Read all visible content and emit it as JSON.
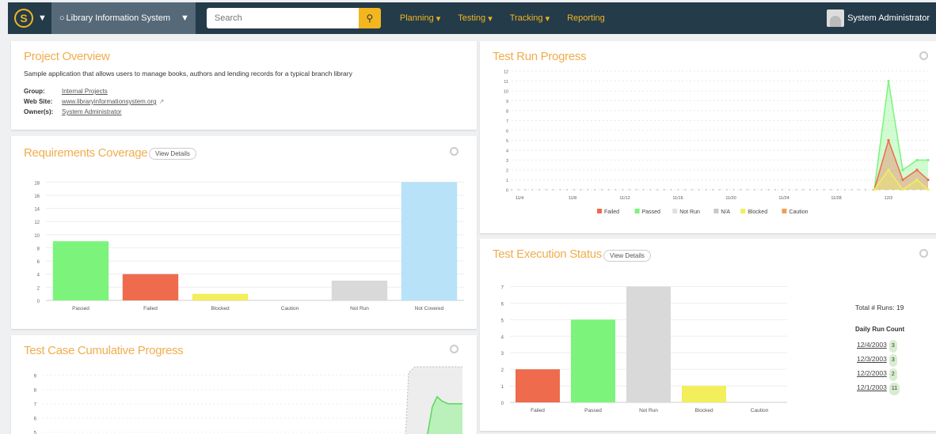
{
  "topbar": {
    "project_name": "Library Information System",
    "search_placeholder": "Search",
    "nav": [
      "Planning",
      "Testing",
      "Tracking",
      "Reporting"
    ],
    "user_name": "System Administrator"
  },
  "overview": {
    "title": "Project Overview",
    "description": "Sample application that allows users to manage books, authors and lending records for a typical branch library",
    "group_label": "Group:",
    "group_value": "Internal Projects",
    "website_label": "Web Site:",
    "website_value": "www.libraryinformationsystem.org",
    "owner_label": "Owner(s):",
    "owner_value": "System Administrator"
  },
  "requirements": {
    "title": "Requirements Coverage",
    "view_details": "View Details"
  },
  "cumulative": {
    "title": "Test Case Cumulative Progress"
  },
  "run_progress": {
    "title": "Test Run Progress"
  },
  "execution": {
    "title": "Test Execution Status",
    "view_details": "View Details",
    "total_runs_label": "Total # Runs:",
    "total_runs_value": "19",
    "daily_label": "Daily Run Count",
    "daily": [
      {
        "date": "12/4/2003",
        "count": "3"
      },
      {
        "date": "12/3/2003",
        "count": "3"
      },
      {
        "date": "12/2/2003",
        "count": "2"
      },
      {
        "date": "12/1/2003",
        "count": "11"
      }
    ]
  },
  "chart_data": [
    {
      "type": "bar",
      "title": "Requirements Coverage",
      "categories": [
        "Passed",
        "Failed",
        "Blocked",
        "Caution",
        "Not Run",
        "Not Covered"
      ],
      "values": [
        9,
        4,
        1,
        0,
        3,
        18
      ],
      "colors": [
        "#7cf47c",
        "#ee6b4d",
        "#f2ee5c",
        "#f0a050",
        "#d9d9d9",
        "#b7e2f7"
      ],
      "yticks": [
        0,
        2,
        4,
        6,
        8,
        10,
        12,
        14,
        16,
        18
      ],
      "ylim": [
        0,
        19
      ]
    },
    {
      "type": "area",
      "title": "Test Run Progress",
      "x": [
        "11/4",
        "11/8",
        "11/12",
        "11/16",
        "11/20",
        "11/24",
        "11/28",
        "12/2"
      ],
      "yticks": [
        0,
        1,
        2,
        3,
        4,
        5,
        6,
        7,
        8,
        9,
        10,
        11,
        12
      ],
      "ylim": [
        0,
        12
      ],
      "legend_position": "bottom",
      "series": [
        {
          "name": "Failed",
          "color": "#ee6b4d"
        },
        {
          "name": "Passed",
          "color": "#7cf47c"
        },
        {
          "name": "Not Run",
          "color": "#e0e0e0"
        },
        {
          "name": "N/A",
          "color": "#c8c8c8"
        },
        {
          "name": "Blocked",
          "color": "#f2ee5c"
        },
        {
          "name": "Caution",
          "color": "#f0a050"
        }
      ],
      "passed_tail": [
        0,
        11,
        2,
        3,
        3
      ],
      "failed_tail": [
        0,
        5,
        1,
        2,
        1
      ],
      "blocked_tail": [
        0,
        2,
        0,
        1,
        0
      ]
    },
    {
      "type": "bar",
      "title": "Test Execution Status",
      "categories": [
        "Failed",
        "Passed",
        "Not Run",
        "Blocked",
        "Caution"
      ],
      "values": [
        2,
        5,
        7,
        1,
        0
      ],
      "colors": [
        "#ee6b4d",
        "#7cf47c",
        "#d9d9d9",
        "#f2ee5c",
        "#f0a050"
      ],
      "yticks": [
        0,
        1,
        2,
        3,
        4,
        5,
        6,
        7
      ],
      "ylim": [
        0,
        7.5
      ]
    },
    {
      "type": "area",
      "title": "Test Case Cumulative Progress",
      "yticks": [
        5,
        6,
        7,
        8,
        9
      ],
      "ylim": [
        4.6,
        9.6
      ]
    }
  ]
}
